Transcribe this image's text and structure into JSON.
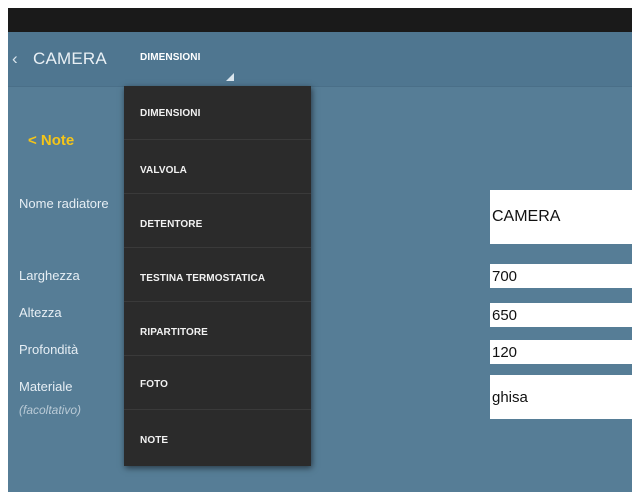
{
  "actionbar": {
    "back_glyph": "‹",
    "title": "CAMERA",
    "spinner_selected": "DIMENSIONI"
  },
  "note_link": "< Note",
  "form": {
    "name_label": "Nome radiatore",
    "name_value": "CAMERA",
    "width_label": "Larghezza",
    "width_value": "700",
    "height_label": "Altezza",
    "height_value": "650",
    "depth_label": "Profondità",
    "depth_value": "120",
    "material_label": "Materiale",
    "material_hint": "(facoltativo)",
    "material_value": "ghisa"
  },
  "dropdown": {
    "items": [
      {
        "label": "DIMENSIONI"
      },
      {
        "label": "VALVOLA"
      },
      {
        "label": "DETENTORE"
      },
      {
        "label": "TESTINA TERMOSTATICA"
      },
      {
        "label": "RIPARTITORE"
      },
      {
        "label": "FOTO"
      },
      {
        "label": "NOTE"
      }
    ]
  },
  "colors": {
    "background": "#567d96",
    "actionbar": "#4f7690",
    "statusbar": "#1a1a1a",
    "dropdown": "#2b2b2b",
    "accent": "#f5c518"
  }
}
